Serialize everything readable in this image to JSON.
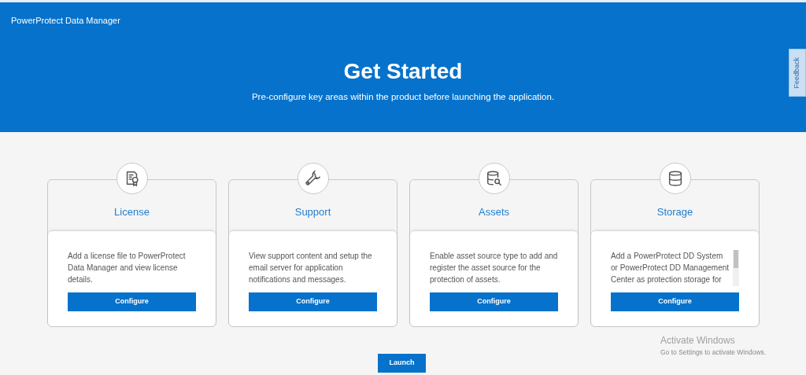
{
  "app_title": "PowerProtect Data Manager",
  "feedback": "Feedback",
  "hero": {
    "title": "Get Started",
    "subtitle": "Pre-configure key areas within the product before launching the application."
  },
  "cards": [
    {
      "kind": "license",
      "title": "License",
      "description": "Add a license file to PowerProtect Data Manager and view license details.",
      "button": "Configure",
      "scrollable": false
    },
    {
      "kind": "support",
      "title": "Support",
      "description": "View support content and setup the email server for application notifications and messages.",
      "button": "Configure",
      "scrollable": false
    },
    {
      "kind": "assets",
      "title": "Assets",
      "description": "Enable asset source type to add and register the asset source for the protection of assets.",
      "button": "Configure",
      "scrollable": false
    },
    {
      "kind": "storage",
      "title": "Storage",
      "description": "Add a PowerProtect DD System or PowerProtect DD Management Center as protection storage for",
      "button": "Configure",
      "scrollable": true
    }
  ],
  "launch_button": "Launch",
  "os_notice": {
    "title": "Activate Windows",
    "text": "Go to Settings to activate Windows."
  }
}
